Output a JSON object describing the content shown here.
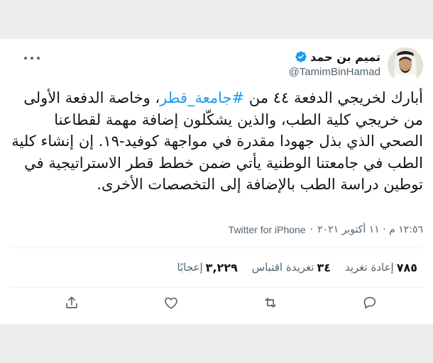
{
  "tweet": {
    "author_name": "تميم بن حمد",
    "handle": "@TamimBinHamad",
    "text_before": "أبارك لخريجي الدفعة ٤٤ من ",
    "hashtag": "#جامعة_قطر",
    "text_after": "، وخاصة الدفعة الأولى من خريجي كلية الطب، والذين يشكّلون إضافة مهمة لقطاعنا الصحي الذي بذل جهودا مقدرة في مواجهة كوفيد-١٩. إن إنشاء كلية الطب في جامعتنا الوطنية يأتي ضمن خطط قطر الاستراتيجية في توطين دراسة الطب بالإضافة إلى التخصصات الأخرى.",
    "timestamp": "١٢:٥٦ م · ١١ أكتوبر ٢٠٢١",
    "separator": "·",
    "source": "Twitter for iPhone"
  },
  "stats": {
    "retweets_count": "٧٨٥",
    "retweets_label": "إعادة تغريد",
    "quotes_count": "٣٤",
    "quotes_label": "تغريدة اقتباس",
    "likes_count": "٣,٢٢٩",
    "likes_label": "إعجابًا"
  },
  "colors": {
    "accent": "#1d9bf0",
    "text": "#0f1419",
    "muted": "#536471"
  },
  "icons": {
    "verified": "verified-badge-icon",
    "more": "more-dots-icon",
    "reply": "reply-icon",
    "retweet": "retweet-icon",
    "like": "heart-icon",
    "share": "share-icon"
  }
}
